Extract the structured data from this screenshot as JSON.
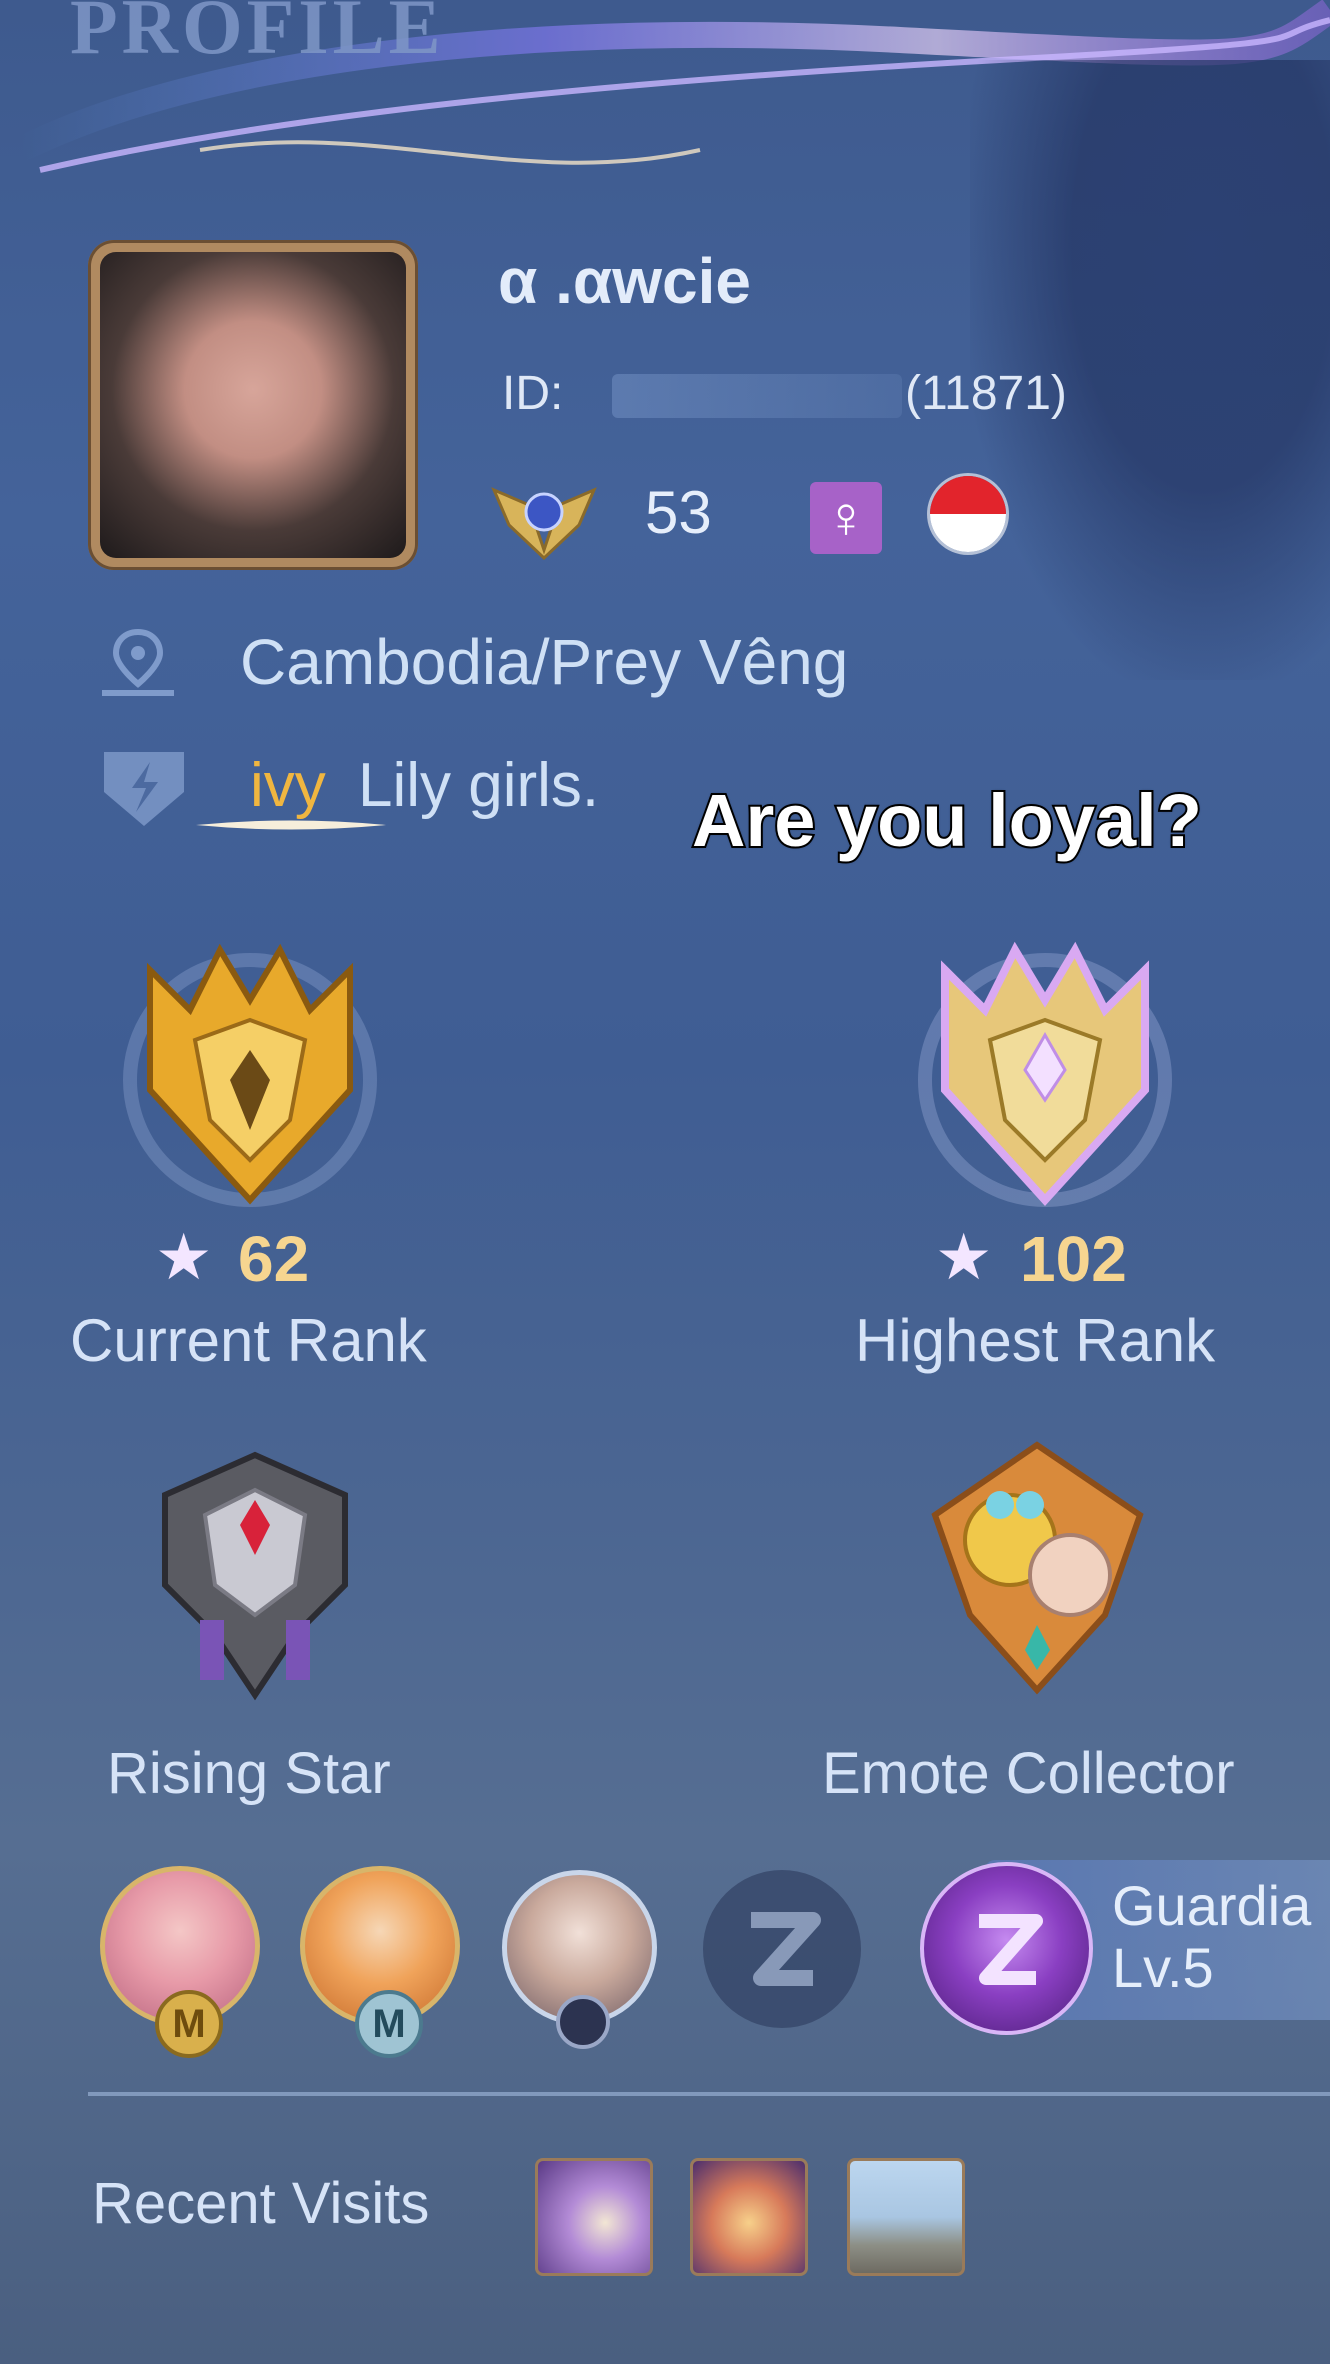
{
  "header": {
    "title": "PROFILE"
  },
  "profile": {
    "username": "α .αwcie",
    "id_label": "ID:",
    "id_suffix": "(11871)",
    "level": "53",
    "gender_symbol": "♀",
    "flag": "red-white-flag",
    "location": "Cambodia/Prey Vêng",
    "squad_tag": "ivy",
    "squad_name": "Lily girls."
  },
  "caption": "Are you loyal?",
  "ranks": {
    "current": {
      "stars": "62",
      "label": "Current Rank"
    },
    "highest": {
      "stars": "102",
      "label": "Highest Rank"
    }
  },
  "achievements": [
    {
      "label": "Rising Star"
    },
    {
      "label": "Emote Collector"
    }
  ],
  "heroes": {
    "guardian_title": "Guardia",
    "guardian_level": "Lv.5"
  },
  "recent_visits": {
    "label": "Recent Visits"
  },
  "colors": {
    "accent_gold": "#f6d590",
    "squad_tag": "#f0b640",
    "gender_badge": "#a762c8"
  }
}
